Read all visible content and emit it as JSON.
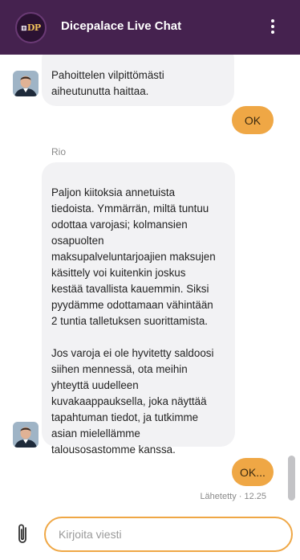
{
  "header": {
    "title": "Dicepalace Live Chat",
    "logo_text": "DP",
    "logo_icon": "dice-icon",
    "menu_icon": "vertical-dots-menu-icon"
  },
  "messages": [
    {
      "type": "agent",
      "text": "Pahoittelen vilpittömästi\naiheutunutta haittaa."
    },
    {
      "type": "user",
      "text": "OK"
    },
    {
      "type": "agent",
      "sender": "Rio",
      "text": "Paljon kiitoksia annetuista\ntiedoista. Ymmärrän, miltä tuntuu\nodottaa varojasi; kolmansien\nosapuolten\nmaksupalveluntarjoajien maksujen\nkäsittely voi kuitenkin joskus\nkestää tavallista kauemmin. Siksi\npyydämme odottamaan vähintään\n2 tuntia talletuksen suorittamista.\n\nJos varoja ei ole hyvitetty saldoosi\nsiihen mennessä, ota meihin\nyhteyttä uudelleen\nkuvakaappauksella, joka näyttää\ntapahtuman tiedot, ja tutkimme\nasian mielellämme\ntalousosastomme kanssa."
    },
    {
      "type": "user",
      "text": "OK...",
      "status": "Lähetetty · 12.25"
    }
  ],
  "composer": {
    "placeholder": "Kirjoita viesti",
    "value": "",
    "attach_icon": "paperclip-icon"
  },
  "colors": {
    "header_bg": "#45224f",
    "accent": "#efa745",
    "agent_bubble": "#f2f2f4"
  }
}
